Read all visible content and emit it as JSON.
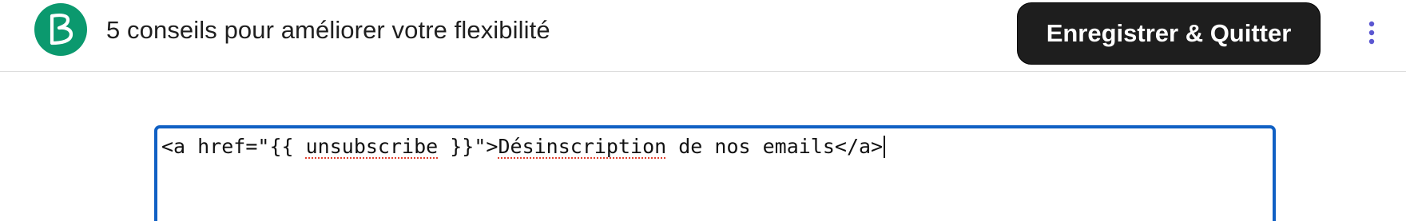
{
  "app": {
    "logo_letter": "B",
    "logo_color": "#0b996e"
  },
  "header": {
    "title": "5 conseils pour améliorer votre flexibilité",
    "save_label": "Enregistrer & Quitter",
    "more_icon": "kebab-menu-icon",
    "more_icon_color": "#5b57d1"
  },
  "editor": {
    "code_prefix": "<a href=\"{{ ",
    "code_word1": "unsubscribe",
    "code_middle": " }}\">",
    "code_word2": "Désinscription",
    "code_suffix": " de nos emails</a>",
    "focus_color": "#1060c4"
  }
}
